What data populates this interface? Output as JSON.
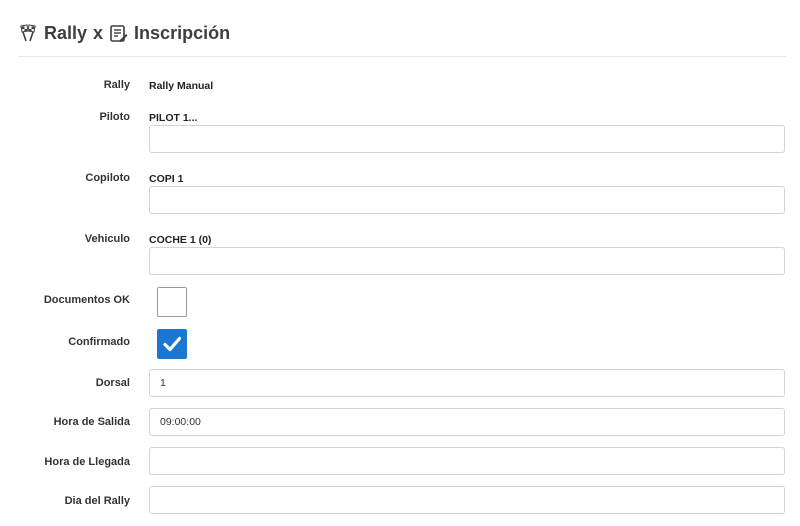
{
  "header": {
    "word1": "Rally",
    "sep": "x",
    "word2": "Inscripción",
    "icon1": "rally-flags-icon",
    "icon2": "form-edit-icon"
  },
  "form": {
    "rally_label": "Rally",
    "rally_value": "Rally Manual",
    "piloto_label": "Piloto",
    "piloto_value": "PILOT 1...",
    "piloto_input": "",
    "copiloto_label": "Copiloto",
    "copiloto_value": "COPI 1",
    "copiloto_input": "",
    "vehiculo_label": "Vehiculo",
    "vehiculo_value": "COCHE 1 (0)",
    "vehiculo_input": "",
    "documentos_label": "Documentos OK",
    "documentos_checked": false,
    "confirmado_label": "Confirmado",
    "confirmado_checked": true,
    "dorsal_label": "Dorsal",
    "dorsal_value": "1",
    "salida_label": "Hora de Salida",
    "salida_value": "09:00:00",
    "llegada_label": "Hora de Llegada",
    "llegada_value": "",
    "dia_label": "Dia del Rally",
    "dia_value": ""
  },
  "colors": {
    "accent": "#1a78d2",
    "border": "#d4d4d4"
  }
}
